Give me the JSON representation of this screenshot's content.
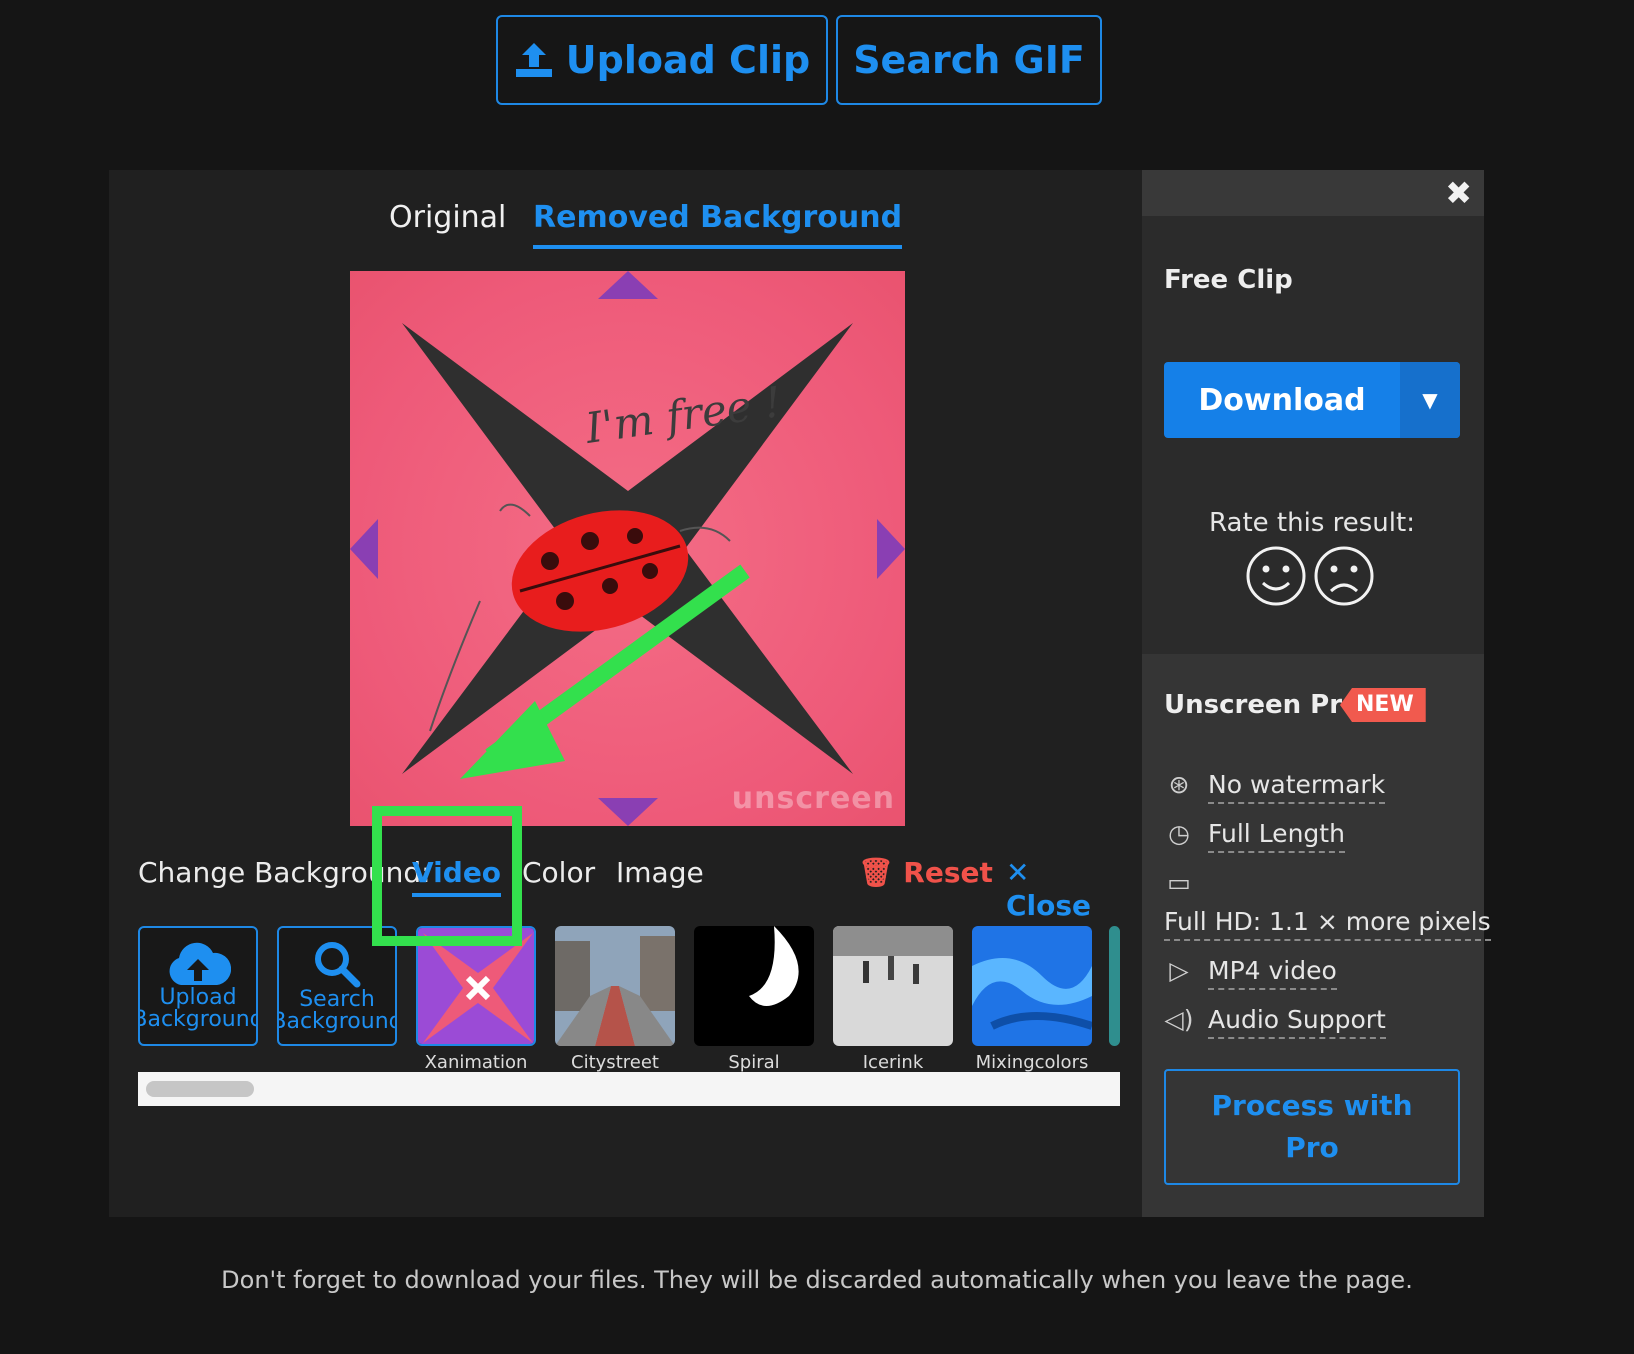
{
  "top_actions": {
    "upload_clip": "Upload Clip",
    "search_gif": "Search GIF"
  },
  "tabs": {
    "original": "Original",
    "removed_background": "Removed Background"
  },
  "preview": {
    "handwriting": "I'm free !",
    "watermark": "unscreen"
  },
  "change_background": {
    "label": "Change Background:",
    "options": [
      "Video",
      "Color",
      "Image"
    ],
    "selected": "Video",
    "reset": "Reset",
    "close": "Close"
  },
  "background_tools": {
    "upload": "Upload Background",
    "search": "Search Background"
  },
  "background_videos": [
    "Xanimation",
    "Citystreet",
    "Spiral",
    "Icerink",
    "Mixingcolors"
  ],
  "sidebar": {
    "free_clip": "Free Clip",
    "download": "Download",
    "rate_label": "Rate this result:",
    "pro_title": "Unscreen Pro",
    "pro_badge": "NEW",
    "features": [
      {
        "icon": "no-watermark-icon",
        "text": "No watermark"
      },
      {
        "icon": "clock-icon",
        "text": "Full Length"
      },
      {
        "icon": "monitor-icon",
        "text": "Full HD: 1.1 × more pixels"
      },
      {
        "icon": "video-file-icon",
        "text": "MP4 video"
      },
      {
        "icon": "speaker-icon",
        "text": "Audio Support"
      }
    ],
    "process_pro": "Process with Pro"
  },
  "footer": "Don't forget to download your files. They will be discarded automatically when you leave the page.",
  "colors": {
    "accent": "#1e8ff0",
    "reset": "#f0524a",
    "highlight_annotation": "#33e04d",
    "preview_bg": "#ee5a79"
  }
}
